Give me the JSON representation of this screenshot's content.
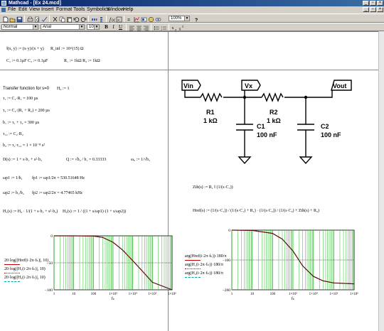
{
  "window": {
    "title": "Mathcad - [Ex 24.mcd]",
    "minimize": "_",
    "restore": "▫",
    "close": "×"
  },
  "menu": [
    "File",
    "Edit",
    "View",
    "Insert",
    "Format",
    "Tools",
    "Symbolics",
    "Window",
    "Help"
  ],
  "toolbar": {
    "zoom": "100%"
  },
  "formatbar": {
    "style": "Normal",
    "font": "Arial",
    "size": "10",
    "bold": "B",
    "italic": "I",
    "underline": "U"
  },
  "defs": {
    "parallel": "‖(x, y) := (x·y)/(x + y)",
    "rinf": "R_inf := 10^(15) Ω",
    "c_line": "C₁ := 0.1µF     C₂ := 0.1µF",
    "r_line": "R₁ := 1kΩ     R₂ := 1kΩ"
  },
  "analysis": {
    "heading": "Transfer function for s=0",
    "h0": "H₀ := 1",
    "t1": "τ₁ := C₁·R₁ = 100 µs",
    "t2": "τ₂ := C₂·(R₁ + R₂) = 200 µs",
    "b1": "b₁ := τ₁ + τ₂ = 300 µs",
    "t12": "τ₁₂ := C₂·R₂",
    "b2": "b₂ := τ₁·τ₁₂ = 1 × 10⁻⁸ s²",
    "ds": "D(s) := 1 + s·b₁ + s²·b₂",
    "q": "Q := √b₂ / b₁ = 0.33333",
    "w0": "ω₀ := 1/√b₂",
    "wp1": "ωp1 := 1/b₁",
    "fp1": "fp1 := ωp1/2π = 530.51648 Hz",
    "wp2": "ωp2 := b₁/b₂",
    "fp2": "fp2 := ωp2/2π = 4.77465 kHz",
    "h1": "H₁(s) := H₀ · 1/(1 + s·b₁ + s²·b₂)",
    "h2": "H₂(s) := 1 / ((1 + s/ωp1)·(1 + s/ωp2))"
  },
  "impedance": {
    "zth": "Zth(s) := R₁ ‖ (1/(s·C₁))",
    "href": "Href(s) := (1/(s·C₁)) / (1/(s·C₁) + R₁) · (1/(s·C₂)) / (1/(s·C₂) + Zth(s) + R₂)"
  },
  "circuit": {
    "nodes": [
      "Vin",
      "Vx",
      "Vout"
    ],
    "r1_name": "R1",
    "r1_val": "1 kΩ",
    "r2_name": "R2",
    "r2_val": "1 kΩ",
    "c1_name": "C1",
    "c1_val": "100 nF",
    "c2_name": "C2",
    "c2_val": "100 nF"
  },
  "plot_left": {
    "legend": [
      "20·log(|Href(i·2π·fₖ)|, 10)",
      "20·log(|H₁(i·2π·fₖ)|, 10)",
      "20·log(|H₂(i·2π·fₖ)|, 10)"
    ],
    "y_top": "0",
    "y_mid": "−50",
    "y_bot": "−100",
    "x_ticks": [
      "1",
      "10",
      "100",
      "1×10³",
      "1×10⁴",
      "1×10⁵",
      "1×10⁶"
    ],
    "xlabel": "fₖ"
  },
  "plot_right": {
    "legend": [
      "arg(Href(i·2π·fₖ))·180/π",
      "arg(H₁(i·2π·fₖ))·180/π",
      "arg(H₂(i·2π·fₖ))·180/π"
    ],
    "y_top": "0",
    "y_mid": "−100",
    "y_bot": "−200",
    "x_ticks": [
      "1",
      "10",
      "100",
      "1×10³",
      "1×10⁴",
      "1×10⁵",
      "1×10⁶"
    ],
    "xlabel": "fₖ"
  },
  "chart_data": [
    {
      "type": "line",
      "x": [
        1,
        10,
        100,
        300,
        1000,
        3000,
        10000,
        30000,
        100000,
        1000000
      ],
      "series": [
        {
          "name": "20·log(|Href(i·2π·fₖ)|, 10)",
          "values": [
            0,
            0,
            -0.4,
            -3,
            -12,
            -26,
            -46,
            -65,
            -86,
            -100
          ]
        },
        {
          "name": "20·log(|H₁(i·2π·fₖ)|, 10)",
          "values": [
            0,
            0,
            -0.4,
            -3,
            -12,
            -26,
            -46,
            -65,
            -86,
            -100
          ]
        },
        {
          "name": "20·log(|H₂(i·2π·fₖ)|, 10)",
          "values": [
            0,
            0,
            -0.4,
            -3,
            -12,
            -26,
            -46,
            -65,
            -86,
            -100
          ]
        }
      ],
      "xscale": "log",
      "xlim": [
        1,
        1000000
      ],
      "ylim": [
        -100,
        0
      ],
      "xlabel": "fₖ",
      "grid": true
    },
    {
      "type": "line",
      "x": [
        1,
        10,
        100,
        300,
        1000,
        3000,
        10000,
        30000,
        100000,
        1000000
      ],
      "series": [
        {
          "name": "arg(Href(i·2π·fₖ))·180/π",
          "values": [
            -0.1,
            -1,
            -11,
            -30,
            -70,
            -120,
            -155,
            -170,
            -177,
            -180
          ]
        },
        {
          "name": "arg(H₁(i·2π·fₖ))·180/π",
          "values": [
            -0.1,
            -1,
            -11,
            -30,
            -70,
            -120,
            -155,
            -170,
            -177,
            -180
          ]
        },
        {
          "name": "arg(H₂(i·2π·fₖ))·180/π",
          "values": [
            -0.1,
            -1,
            -11,
            -30,
            -70,
            -120,
            -155,
            -170,
            -177,
            -180
          ]
        }
      ],
      "xscale": "log",
      "xlim": [
        1,
        1000000
      ],
      "ylim": [
        -200,
        0
      ],
      "xlabel": "fₖ",
      "grid": true
    }
  ],
  "colors": {
    "curve": "#8b0000",
    "grid": "#2fbf2f",
    "titlebar": "#0a246a",
    "legend1": "#c00000",
    "legend2": "#c00000",
    "legend3": "#00a0a0"
  }
}
